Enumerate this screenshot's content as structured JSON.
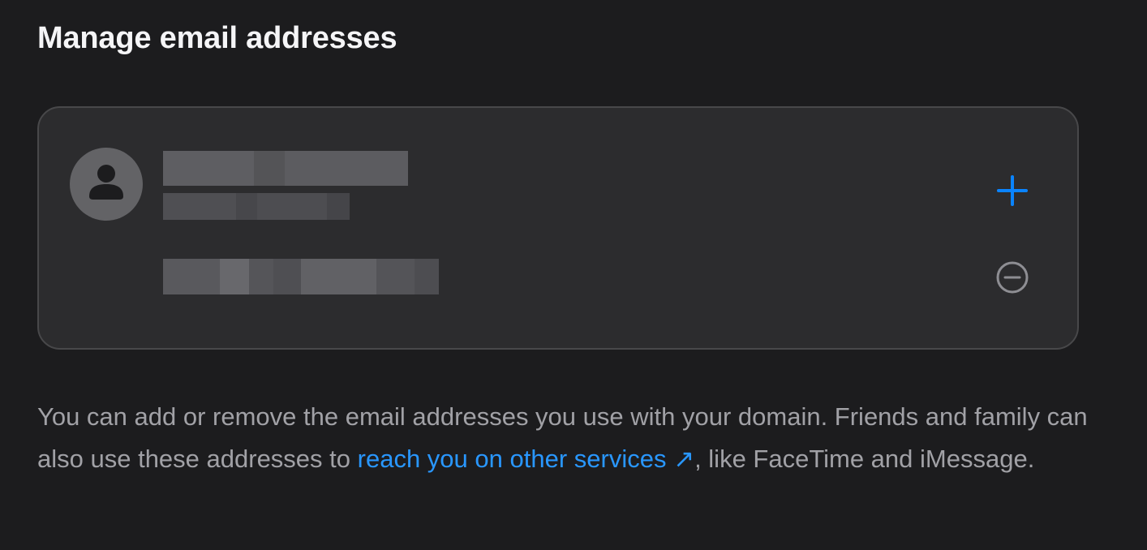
{
  "header": {
    "title": "Manage email addresses"
  },
  "card": {
    "add_icon": "plus-icon",
    "remove_icon": "minus-circle-icon",
    "avatar_icon": "person-icon"
  },
  "description": {
    "text_before": "You can add or remove the email addresses you use with your domain. Friends and family can also use these addresses to ",
    "link_text": "reach you on other services",
    "link_arrow": "↗",
    "text_after": ", like FaceTime and iMessage."
  },
  "colors": {
    "background": "#1c1c1e",
    "card": "#2c2c2e",
    "accent": "#0a84ff",
    "link": "#2997ff",
    "annotation_arrow": "#f07575"
  }
}
